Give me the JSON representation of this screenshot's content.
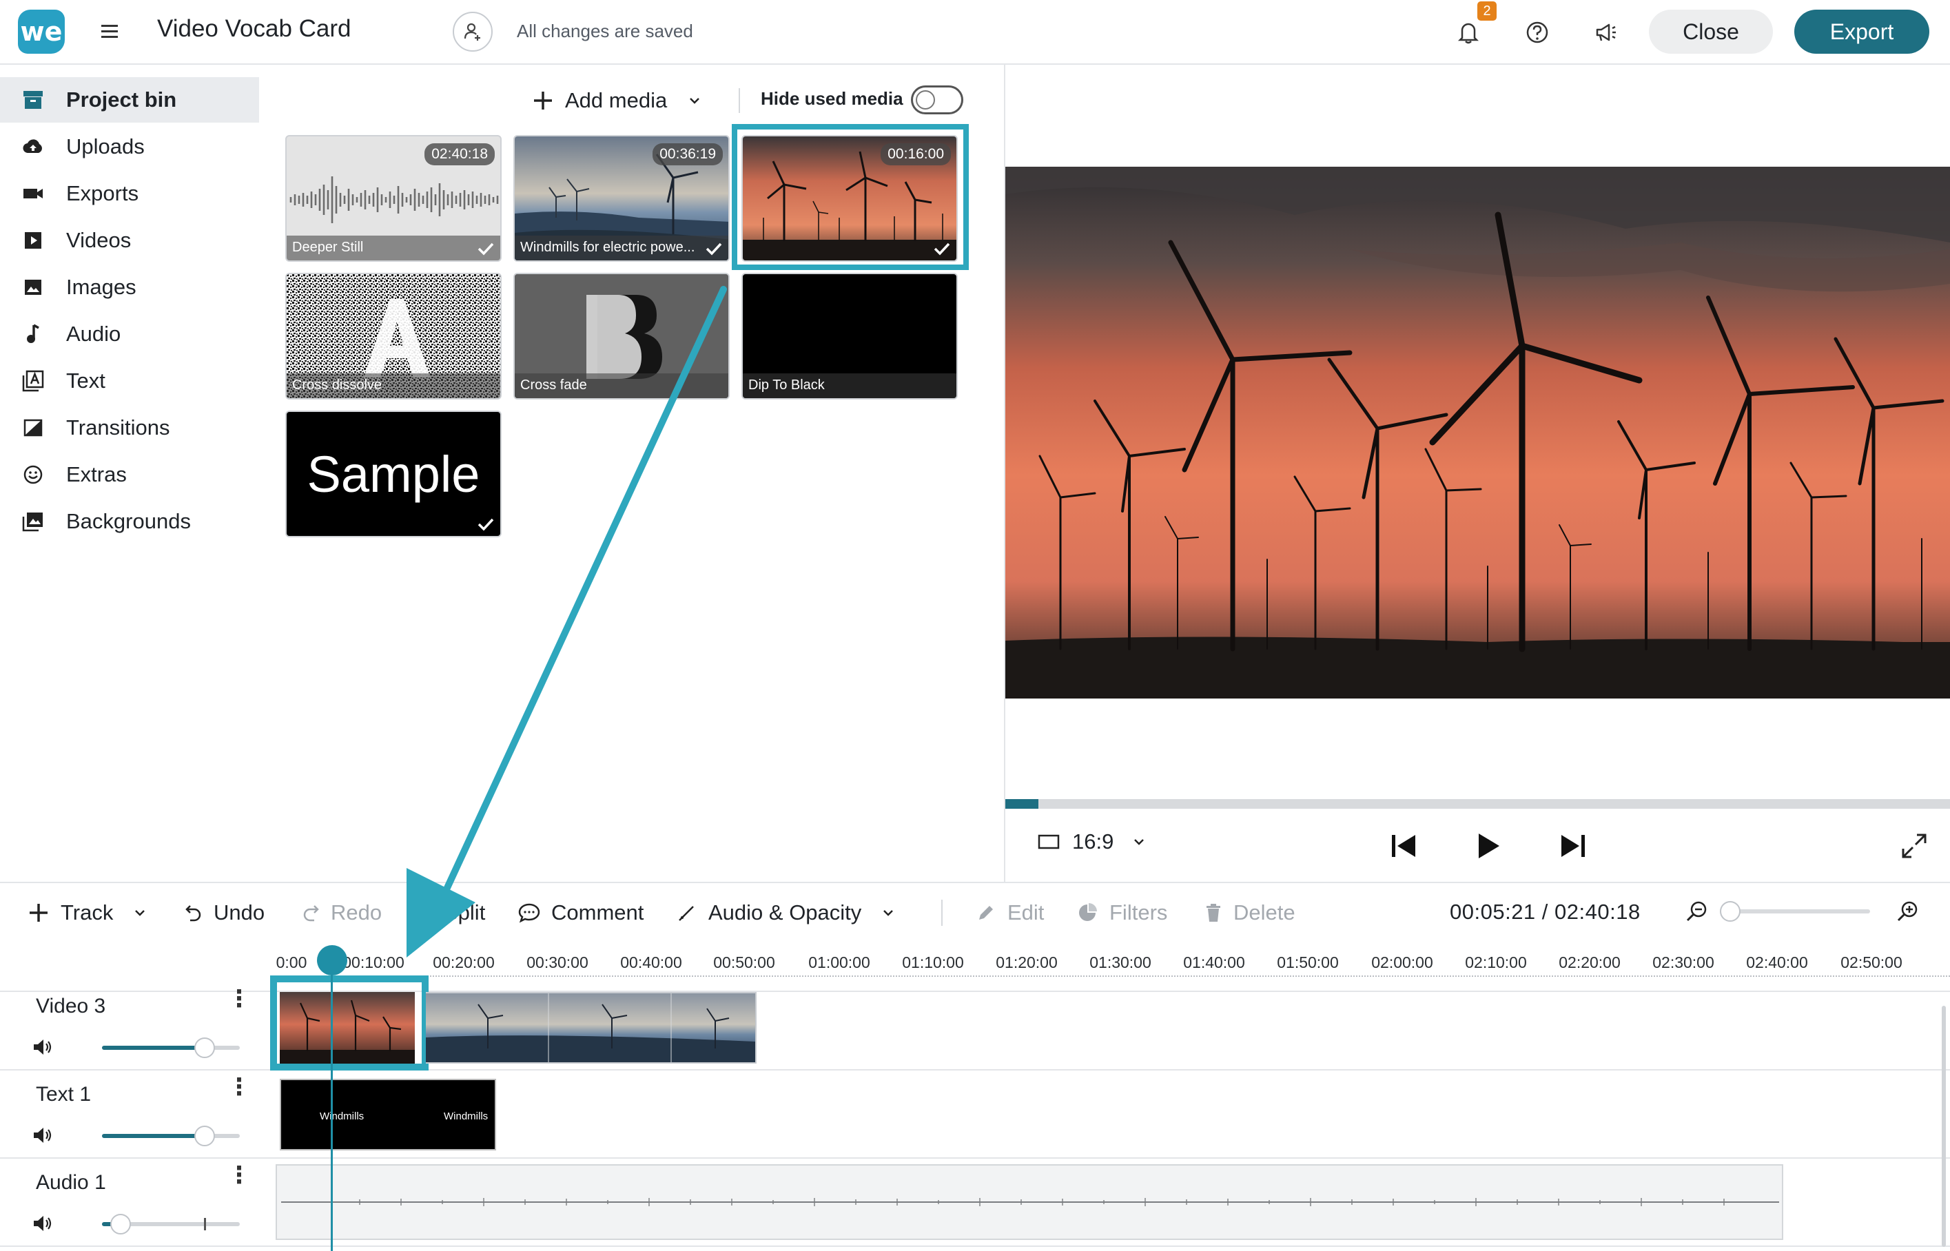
{
  "header": {
    "logo_text": "we",
    "project_title": "Video Vocab Card",
    "save_status": "All changes are saved",
    "notification_count": "2",
    "close_label": "Close",
    "export_label": "Export",
    "accent_color": "#1e6f82"
  },
  "sidebar": {
    "items": [
      {
        "label": "Project bin",
        "icon": "archive-icon",
        "active": true
      },
      {
        "label": "Uploads",
        "icon": "cloud-upload-icon"
      },
      {
        "label": "Exports",
        "icon": "video-camera-icon"
      },
      {
        "label": "Videos",
        "icon": "play-square-icon"
      },
      {
        "label": "Images",
        "icon": "image-icon"
      },
      {
        "label": "Audio",
        "icon": "music-note-icon"
      },
      {
        "label": "Text",
        "icon": "text-icon"
      },
      {
        "label": "Transitions",
        "icon": "transition-icon"
      },
      {
        "label": "Extras",
        "icon": "smiley-icon"
      },
      {
        "label": "Backgrounds",
        "icon": "backgrounds-icon"
      }
    ]
  },
  "media_panel": {
    "add_media_label": "Add media",
    "hide_used_label": "Hide used media",
    "hide_used_enabled": false,
    "items": [
      {
        "caption": "Deeper Still",
        "duration": "02:40:18",
        "used": true,
        "kind": "audio"
      },
      {
        "caption": "Windmills for electric powe...",
        "duration": "00:36:19",
        "used": true,
        "kind": "video"
      },
      {
        "caption": "",
        "duration": "00:16:00",
        "used": true,
        "kind": "video",
        "selected": true
      },
      {
        "caption": "Cross dissolve",
        "kind": "transition"
      },
      {
        "caption": "Cross fade",
        "kind": "transition"
      },
      {
        "caption": "Dip To Black",
        "kind": "transition"
      },
      {
        "caption": "Sample",
        "used": true,
        "kind": "text"
      }
    ]
  },
  "preview": {
    "aspect_ratio": "16:9",
    "progress_fraction": 0.035
  },
  "toolbar": {
    "track_label": "Track",
    "undo_label": "Undo",
    "redo_label": "Redo",
    "split_label": "Split",
    "comment_label": "Comment",
    "audio_opacity_label": "Audio & Opacity",
    "edit_label": "Edit",
    "filters_label": "Filters",
    "delete_label": "Delete",
    "timecode": "00:05:21 / 02:40:18"
  },
  "timeline": {
    "ruler": [
      "0:00",
      "00:10:00",
      "00:20:00",
      "00:30:00",
      "00:40:00",
      "00:50:00",
      "01:00:00",
      "01:10:00",
      "01:20:00",
      "01:30:00",
      "01:40:00",
      "01:50:00",
      "02:00:00",
      "02:10:00",
      "02:20:00",
      "02:30:00",
      "02:40:00",
      "02:50:00"
    ],
    "tracks": [
      {
        "name": "Video 3",
        "volume": 0.75
      },
      {
        "name": "Text 1",
        "volume": 0.75
      },
      {
        "name": "Audio 1",
        "volume": 0.1
      }
    ],
    "text_clip_labels": [
      "Windmills",
      "Windmills"
    ]
  }
}
